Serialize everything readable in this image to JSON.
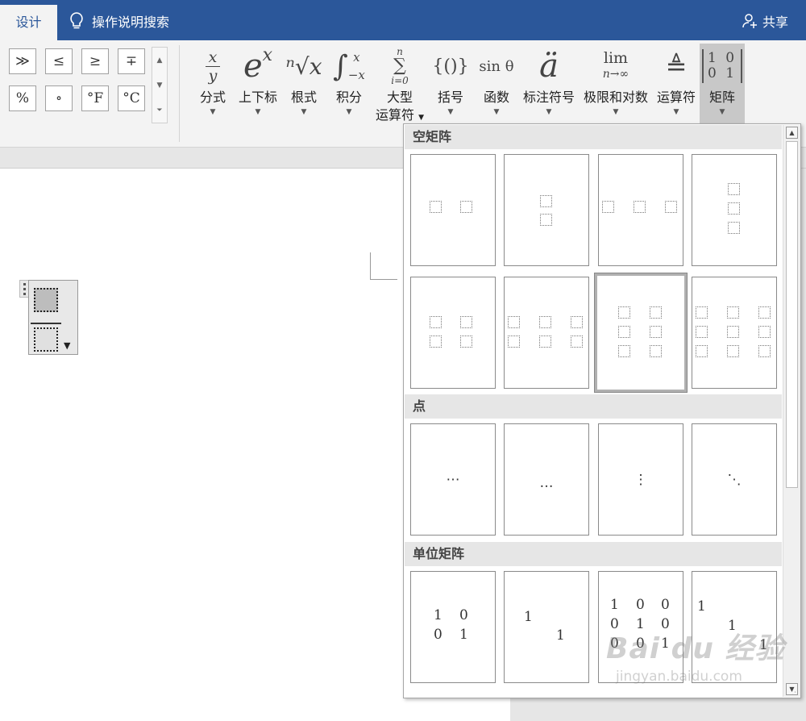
{
  "titlebar": {
    "tab_design": "设计",
    "tell_me": "操作说明搜索",
    "share": "共享",
    "colors": {
      "bar": "#2b579a"
    }
  },
  "symbols": {
    "row1": [
      "≫",
      "≤",
      "≥",
      "∓"
    ],
    "row2": [
      "%",
      "∘",
      "°F",
      "°C"
    ]
  },
  "ribbon_buttons": [
    {
      "label": "分式",
      "icon": "fraction-icon"
    },
    {
      "label": "上下标",
      "icon": "script-icon"
    },
    {
      "label": "根式",
      "icon": "radical-icon"
    },
    {
      "label": "积分",
      "icon": "integral-icon"
    },
    {
      "label": "大型运算符",
      "label_line1": "大型",
      "label_line2": "运算符",
      "icon": "large-operator-icon"
    },
    {
      "label": "括号",
      "icon": "bracket-icon"
    },
    {
      "label": "函数",
      "icon": "function-icon"
    },
    {
      "label": "标注符号",
      "icon": "accent-icon"
    },
    {
      "label": "极限和对数",
      "icon": "limit-log-icon"
    },
    {
      "label": "运算符",
      "icon": "operator-icon"
    },
    {
      "label": "矩阵",
      "icon": "matrix-icon",
      "active": true
    }
  ],
  "icon_text": {
    "fraction_num": "x",
    "fraction_den": "y",
    "script_base": "e",
    "script_sup": "x",
    "radical": "ⁿ√x",
    "integral": "∫",
    "integral_up": "x",
    "integral_low": "−x",
    "sum_top": "n",
    "sum": "∑",
    "sum_bottom": "i=0",
    "bracket": "{()}",
    "function": "sin θ",
    "accent": "ä",
    "limit_top": "lim",
    "limit_bottom": "n→∞",
    "operator": "≜",
    "matrix_row1": "1 0",
    "matrix_row2": "0 1"
  },
  "panel": {
    "sections": [
      {
        "title": "空矩阵"
      },
      {
        "title": "点"
      },
      {
        "title": "单位矩阵"
      }
    ],
    "dots": [
      "⋯",
      "…",
      "⋮",
      "⋱"
    ],
    "identity": {
      "t1": [
        "1",
        "0",
        "0",
        "1"
      ],
      "t2": [
        "1",
        "1"
      ],
      "t3": [
        "1",
        "0",
        "0",
        "0",
        "1",
        "0",
        "0",
        "0",
        "1"
      ],
      "t4": [
        "1",
        "1",
        "1"
      ]
    }
  },
  "watermark": {
    "brand": "Bai du 经验",
    "url": "jingyan.baidu.com"
  }
}
